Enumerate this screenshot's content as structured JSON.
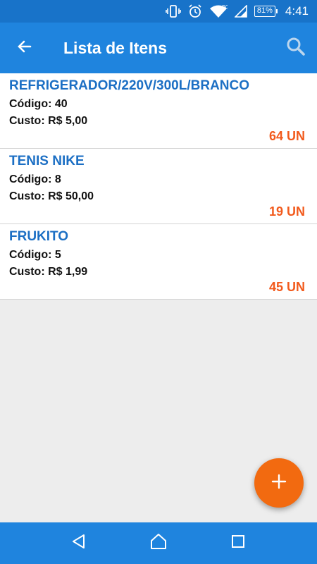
{
  "status_bar": {
    "network_label": "3G",
    "battery": "81%",
    "time": "4:41",
    "icons": [
      "vibrate-icon",
      "alarm-icon",
      "wifi-icon",
      "signal-icon",
      "battery-icon"
    ]
  },
  "app_bar": {
    "title": "Lista de Itens",
    "back_icon": "arrow-back-icon",
    "search_icon": "search-icon"
  },
  "items": [
    {
      "name": "REFRIGERADOR/220V/300L/BRANCO",
      "code": "Código: 40",
      "cost": "Custo: R$ 5,00",
      "qty": "64 UN"
    },
    {
      "name": "TENIS NIKE",
      "code": "Código: 8",
      "cost": "Custo: R$ 50,00",
      "qty": "19 UN"
    },
    {
      "name": "FRUKITO",
      "code": "Código: 5",
      "cost": "Custo: R$ 1,99",
      "qty": "45 UN"
    }
  ],
  "fab": {
    "icon": "plus-icon"
  },
  "nav_bar": {
    "icons": [
      "back-triangle-icon",
      "home-icon",
      "recents-square-icon"
    ]
  },
  "colors": {
    "primary": "#1f84de",
    "status_bar": "#1873c9",
    "item_name": "#1c6fc4",
    "quantity": "#f25a1c",
    "fab": "#f26a10"
  }
}
